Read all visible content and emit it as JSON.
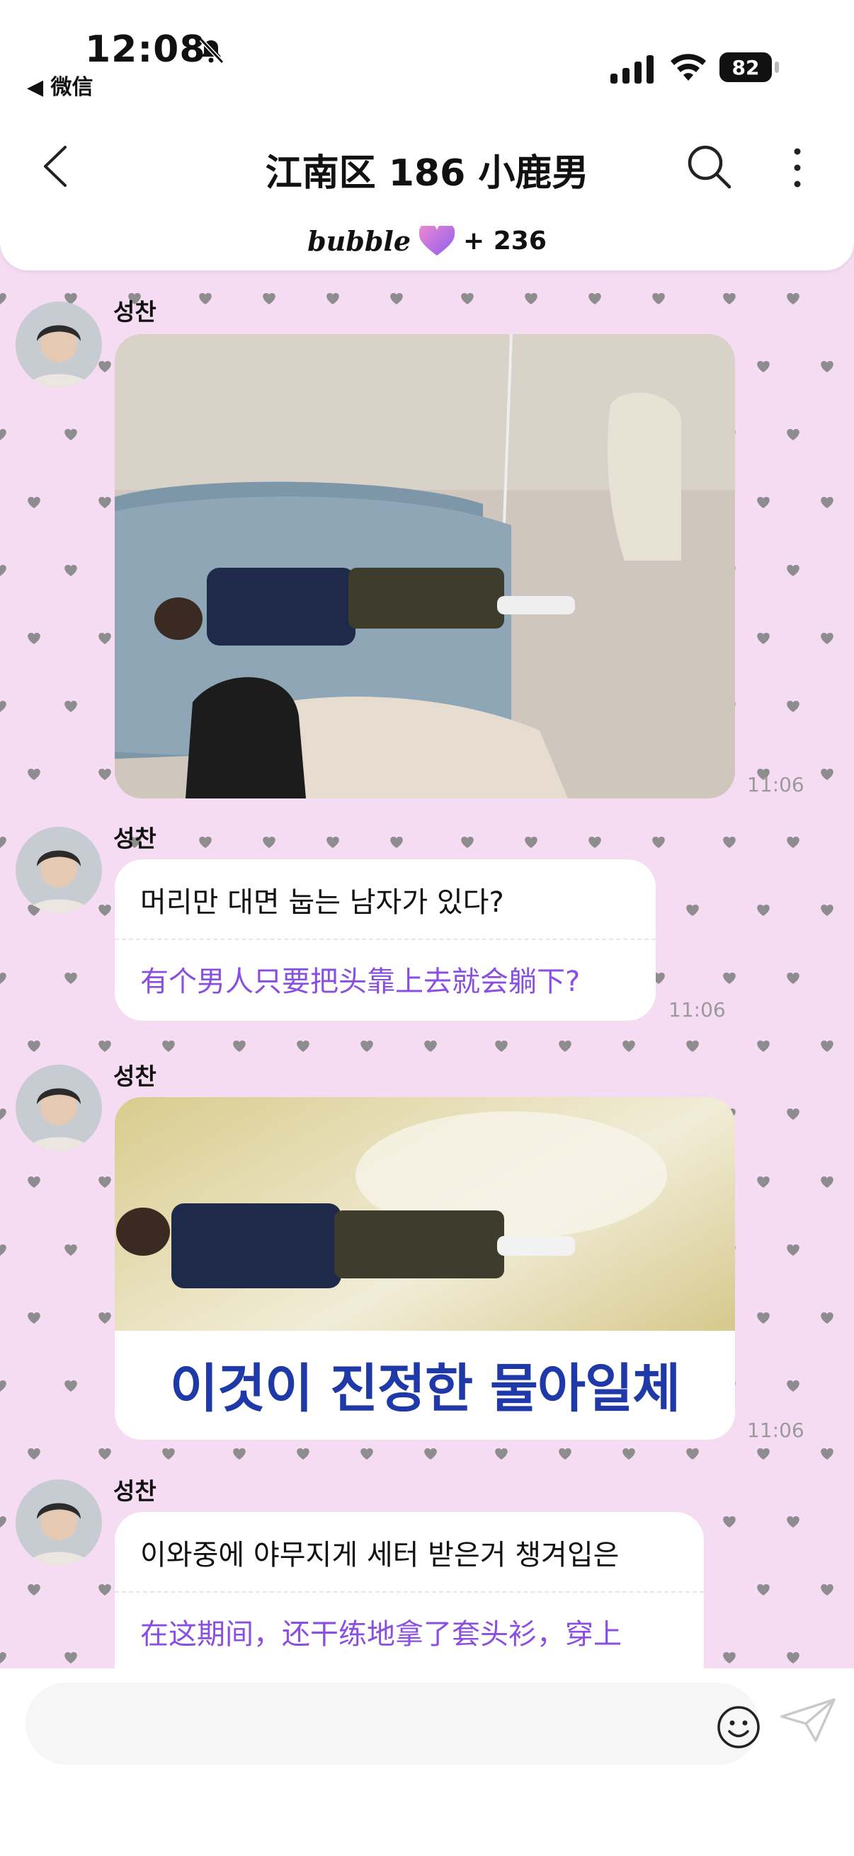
{
  "status": {
    "time": "12:08",
    "back_app": "◀ 微信",
    "battery": "82"
  },
  "header": {
    "title": "江南区 186 小鹿男",
    "brand": "bubble",
    "count": "+ 236"
  },
  "messages": [
    {
      "sender": "성찬",
      "time": "11:06"
    },
    {
      "sender": "성찬",
      "ko": "머리만 대면 눕는 남자가 있다?",
      "zh": "有个男人只要把头靠上去就会躺下?",
      "time": "11:06"
    },
    {
      "sender": "성찬",
      "caption": "이것이 진정한 물아일체",
      "time": "11:06"
    },
    {
      "sender": "성찬",
      "ko": "이와중에 야무지게 세터 받은거 챙겨입은",
      "zh": "在这期间，还干练地拿了套头衫，穿上"
    }
  ],
  "input": {
    "placeholder": ""
  },
  "colors": {
    "background": "#f6dcf3",
    "accent": "#8a4fe0",
    "heart": "#8d8d8d"
  }
}
